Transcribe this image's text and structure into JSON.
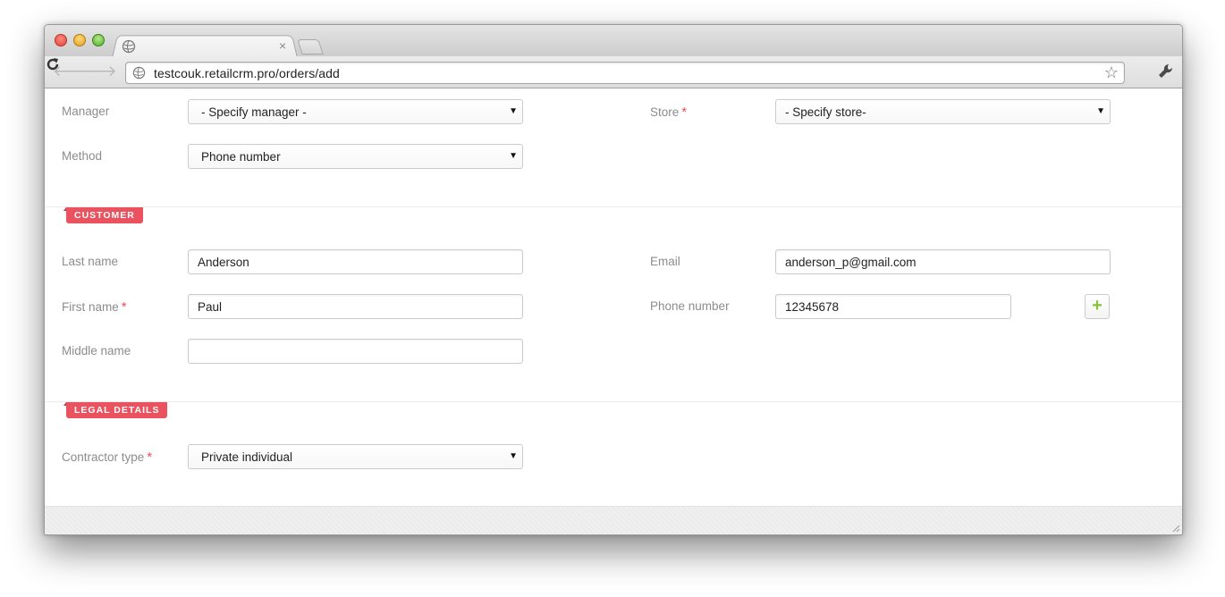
{
  "browser": {
    "url": "testcouk.retailcrm.pro/orders/add",
    "tab_close": "×",
    "icons": {
      "back": "back-arrow-icon",
      "forward": "forward-arrow-icon",
      "reload": "reload-icon",
      "star": "bookmark-star-icon",
      "wrench": "wrench-icon",
      "globe": "globe-icon"
    }
  },
  "order": {
    "manager": {
      "label": "Manager",
      "value": "- Specify manager -"
    },
    "store": {
      "label": "Store",
      "required_mark": "*",
      "value": "- Specify store-"
    },
    "method": {
      "label": "Method",
      "value": "Phone number"
    }
  },
  "customer": {
    "section_title": "CUSTOMER",
    "last_name": {
      "label": "Last name",
      "value": "Anderson"
    },
    "first_name": {
      "label": "First name",
      "required_mark": "*",
      "value": "Paul"
    },
    "middle_name": {
      "label": "Middle name",
      "value": ""
    },
    "email": {
      "label": "Email",
      "value": "anderson_p@gmail.com"
    },
    "phone": {
      "label": "Phone number",
      "value": "12345678",
      "add_label": "+"
    }
  },
  "legal": {
    "section_title": "LEGAL DETAILS",
    "contractor_type": {
      "label": "Contractor type",
      "required_mark": "*",
      "value": "Private individual"
    }
  },
  "colors": {
    "accent_red": "#e9525e",
    "add_green": "#86c23a",
    "label_gray": "#8c8c8c"
  }
}
